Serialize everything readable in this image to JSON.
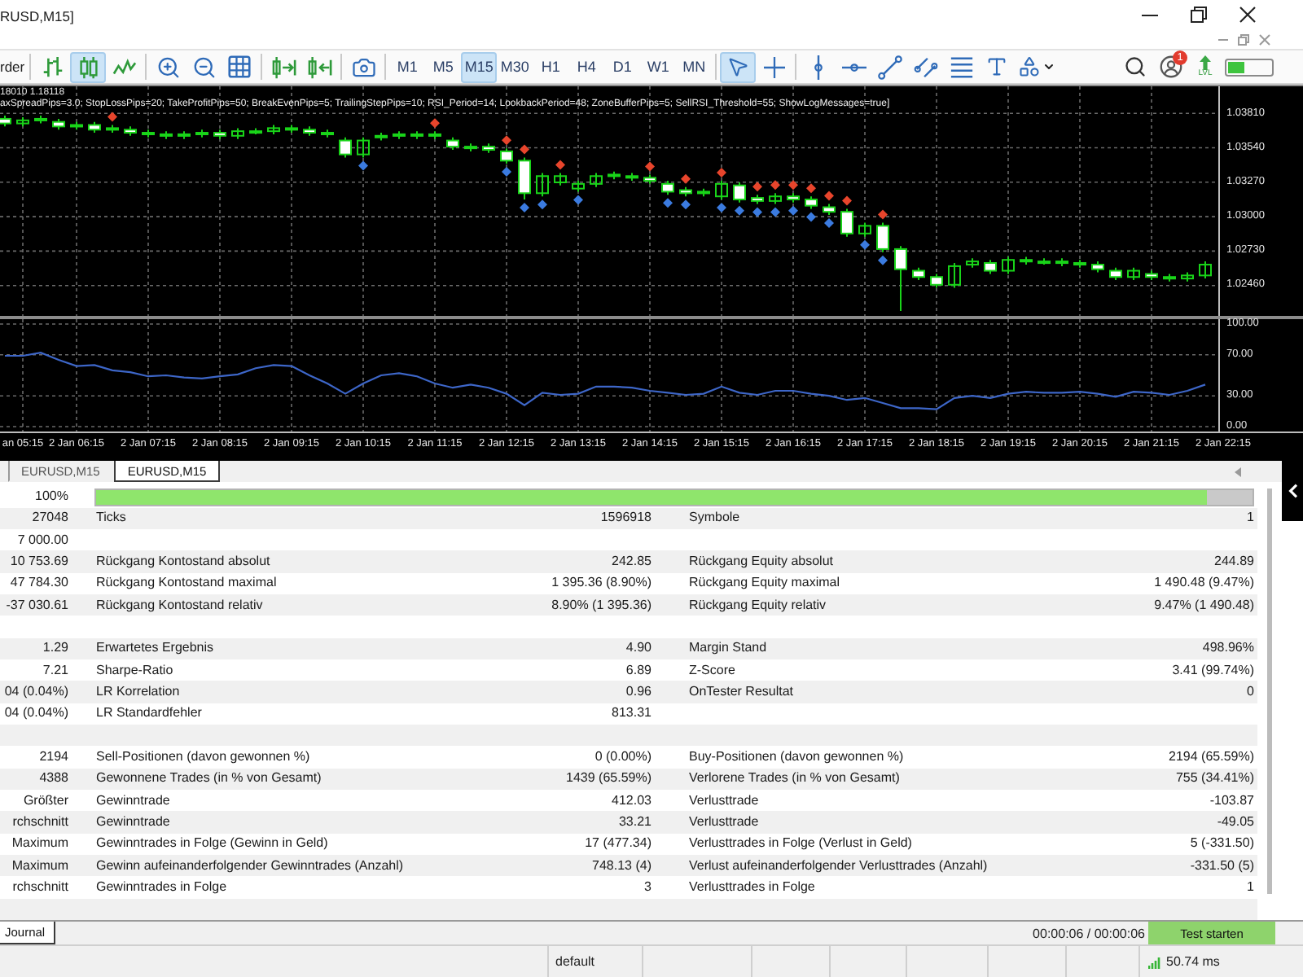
{
  "window": {
    "title": "RUSD,M15]"
  },
  "toolbar": {
    "order_label": "rder",
    "chart_types": [
      {
        "kind": "bars",
        "selected": false
      },
      {
        "kind": "candles",
        "selected": true
      },
      {
        "kind": "line",
        "selected": false
      }
    ],
    "timeframes": [
      {
        "label": "M1",
        "selected": false
      },
      {
        "label": "M5",
        "selected": false
      },
      {
        "label": "M15",
        "selected": true
      },
      {
        "label": "M30",
        "selected": false
      },
      {
        "label": "H1",
        "selected": false
      },
      {
        "label": "H4",
        "selected": false
      },
      {
        "label": "D1",
        "selected": false
      },
      {
        "label": "W1",
        "selected": false
      },
      {
        "label": "MN",
        "selected": false
      }
    ],
    "pointer_tools": [
      {
        "kind": "cursor",
        "selected": true
      },
      {
        "kind": "crosshair",
        "selected": false
      }
    ],
    "object_tools": [
      {
        "kind": "vline",
        "selected": false
      },
      {
        "kind": "hline",
        "selected": false
      },
      {
        "kind": "trendline",
        "selected": false
      },
      {
        "kind": "channel",
        "selected": false
      },
      {
        "kind": "fibo",
        "selected": false
      },
      {
        "kind": "text",
        "selected": false
      },
      {
        "kind": "shapes",
        "selected": false
      }
    ],
    "notification_count": "1",
    "level_label": "LVL"
  },
  "chart": {
    "info": "18010 1.18118",
    "parameters": "axSpreadPips=3.0; StopLossPips=20; TakeProfitPips=50; BreakEvenPips=5; TrailingStepPips=10; RSI_Period=14; LookbackPeriod=48; ZoneBufferPips=5; SellRSI_Threshold=55; ShowLogMessages=true]",
    "chart_data": {
      "type": "candlestick",
      "grid": true,
      "categories": [
        null,
        null,
        null,
        null,
        null,
        null,
        null,
        null,
        null,
        null,
        null,
        null,
        null,
        null,
        null,
        null,
        null,
        null,
        null,
        null,
        null,
        null,
        null,
        null,
        null,
        null,
        null,
        null,
        null,
        null,
        null,
        null,
        null,
        null,
        null,
        null,
        null,
        null,
        null,
        null,
        null,
        null,
        null,
        null,
        null,
        null,
        null,
        null,
        null,
        null,
        null,
        null,
        null,
        null,
        null,
        null,
        null,
        null,
        null,
        null,
        null,
        null,
        null,
        null,
        null,
        null,
        null,
        null
      ],
      "ylim": [
        1.02222,
        1.04022
      ],
      "yticks": [
        {
          "value": 1.0381,
          "label": "1.03810"
        },
        {
          "value": 1.0354,
          "label": "1.03540"
        },
        {
          "value": 1.0327,
          "label": "1.03270"
        },
        {
          "value": 1.03,
          "label": "1.03000"
        },
        {
          "value": 1.0273,
          "label": "1.02730"
        },
        {
          "value": 1.0246,
          "label": "1.02460"
        }
      ],
      "ohlc": [
        [
          1.03767,
          1.03792,
          1.03707,
          1.03731
        ],
        [
          1.03731,
          1.0378,
          1.03707,
          1.03755
        ],
        [
          1.03755,
          1.03792,
          1.03731,
          1.03767
        ],
        [
          1.03743,
          1.03767,
          1.03682,
          1.03707
        ],
        [
          1.03707,
          1.03743,
          1.03682,
          1.03719
        ],
        [
          1.03719,
          1.03743,
          1.03658,
          1.03682
        ],
        [
          1.03694,
          1.03719,
          1.03658,
          1.03682
        ],
        [
          1.03682,
          1.03707,
          1.03634,
          1.03658
        ],
        [
          1.03658,
          1.03682,
          1.03622,
          1.03646
        ],
        [
          1.03646,
          1.0367,
          1.03609,
          1.03634
        ],
        [
          1.03634,
          1.0367,
          1.03609,
          1.03646
        ],
        [
          1.03646,
          1.03682,
          1.03622,
          1.03658
        ],
        [
          1.03658,
          1.03682,
          1.03609,
          1.03634
        ],
        [
          1.03634,
          1.03694,
          1.03609,
          1.0367
        ],
        [
          1.0367,
          1.03694,
          1.03646,
          1.0367
        ],
        [
          1.0367,
          1.03719,
          1.03646,
          1.03694
        ],
        [
          1.03694,
          1.03719,
          1.03658,
          1.03682
        ],
        [
          1.03682,
          1.03707,
          1.03634,
          1.03658
        ],
        [
          1.03658,
          1.03682,
          1.03622,
          1.03646
        ],
        [
          1.03597,
          1.03622,
          1.03463,
          1.03488
        ],
        [
          1.03488,
          1.03622,
          1.03463,
          1.03597
        ],
        [
          1.03622,
          1.03658,
          1.03597,
          1.03634
        ],
        [
          1.03634,
          1.0367,
          1.03609,
          1.03646
        ],
        [
          1.03646,
          1.0367,
          1.03609,
          1.03634
        ],
        [
          1.03634,
          1.0367,
          1.03609,
          1.03646
        ],
        [
          1.03597,
          1.03622,
          1.03524,
          1.03549
        ],
        [
          1.03549,
          1.03573,
          1.03512,
          1.03536
        ],
        [
          1.03549,
          1.03573,
          1.035,
          1.03524
        ],
        [
          1.03512,
          1.03536,
          1.03415,
          1.03439
        ],
        [
          1.03439,
          1.03463,
          1.03135,
          1.03184
        ],
        [
          1.03184,
          1.03342,
          1.03159,
          1.03318
        ],
        [
          1.03269,
          1.03342,
          1.03245,
          1.03318
        ],
        [
          1.0322,
          1.03281,
          1.03196,
          1.03257
        ],
        [
          1.03257,
          1.03342,
          1.03232,
          1.03318
        ],
        [
          1.03318,
          1.03354,
          1.03293,
          1.0333
        ],
        [
          1.03318,
          1.03342,
          1.03281,
          1.03305
        ],
        [
          1.03305,
          1.0333,
          1.03257,
          1.03281
        ],
        [
          1.03257,
          1.03281,
          1.03172,
          1.03196
        ],
        [
          1.03208,
          1.03232,
          1.03159,
          1.03184
        ],
        [
          1.03196,
          1.0322,
          1.03159,
          1.03184
        ],
        [
          1.03159,
          1.03281,
          1.03135,
          1.03257
        ],
        [
          1.03245,
          1.03269,
          1.03111,
          1.03135
        ],
        [
          1.03147,
          1.03172,
          1.03099,
          1.03123
        ],
        [
          1.03123,
          1.03184,
          1.03099,
          1.03159
        ],
        [
          1.03159,
          1.03184,
          1.03111,
          1.03135
        ],
        [
          1.03135,
          1.03159,
          1.03062,
          1.03086
        ],
        [
          1.03074,
          1.03099,
          1.03014,
          1.03038
        ],
        [
          1.03038,
          1.03062,
          1.02843,
          1.02868
        ],
        [
          1.02868,
          1.02953,
          1.02843,
          1.02928
        ],
        [
          1.02928,
          1.02953,
          1.02722,
          1.02746
        ],
        [
          1.02746,
          1.0277,
          1.0226,
          1.02588
        ],
        [
          1.02576,
          1.026,
          1.02503,
          1.02527
        ],
        [
          1.02527,
          1.02551,
          1.02442,
          1.02466
        ],
        [
          1.02466,
          1.02637,
          1.02442,
          1.02612
        ],
        [
          1.02624,
          1.02673,
          1.026,
          1.02649
        ],
        [
          1.02637,
          1.02661,
          1.02551,
          1.02576
        ],
        [
          1.02576,
          1.02685,
          1.02551,
          1.02661
        ],
        [
          1.02649,
          1.02685,
          1.02624,
          1.02661
        ],
        [
          1.02649,
          1.02673,
          1.02624,
          1.02649
        ],
        [
          1.02649,
          1.02673,
          1.02612,
          1.02637
        ],
        [
          1.02637,
          1.02661,
          1.026,
          1.02624
        ],
        [
          1.02624,
          1.02649,
          1.02564,
          1.02588
        ],
        [
          1.02576,
          1.026,
          1.02503,
          1.02527
        ],
        [
          1.02527,
          1.026,
          1.02503,
          1.02576
        ],
        [
          1.02551,
          1.02576,
          1.02503,
          1.02527
        ],
        [
          1.02527,
          1.02551,
          1.02491,
          1.02515
        ],
        [
          1.02515,
          1.02564,
          1.02491,
          1.02539
        ],
        [
          1.02539,
          1.02649,
          1.02515,
          1.02624
        ]
      ]
    },
    "indicator": {
      "chart_data": {
        "type": "line",
        "grid": true,
        "categories": [
          null,
          "an 05:15",
          null,
          null,
          "2 Jan 06:15",
          null,
          null,
          null,
          "2 Jan 07:15",
          null,
          null,
          null,
          "2 Jan 08:15",
          null,
          null,
          null,
          "2 Jan 09:15",
          null,
          null,
          null,
          "2 Jan 10:15",
          null,
          null,
          null,
          "2 Jan 11:15",
          null,
          null,
          null,
          "2 Jan 12:15",
          null,
          null,
          null,
          "2 Jan 13:15",
          null,
          null,
          null,
          "2 Jan 14:15",
          null,
          null,
          null,
          "2 Jan 15:15",
          null,
          null,
          null,
          "2 Jan 16:15",
          null,
          null,
          null,
          "2 Jan 17:15",
          null,
          null,
          null,
          "2 Jan 18:15",
          null,
          null,
          null,
          "2 Jan 19:15",
          null,
          null,
          null,
          "2 Jan 20:15",
          null,
          null,
          null,
          "2 Jan 21:15",
          null,
          null,
          null,
          "2 Jan 22:15"
        ],
        "values": [
          69,
          69,
          72,
          65,
          59,
          60,
          55,
          53,
          49,
          50,
          48,
          47,
          49,
          51,
          57,
          60,
          59,
          50,
          42,
          32,
          42,
          50,
          52,
          49,
          42,
          38,
          41,
          38,
          32,
          21,
          33,
          31,
          32,
          39,
          39,
          38,
          35,
          33,
          31,
          32,
          39,
          33,
          31,
          35,
          35,
          32,
          30,
          26,
          28,
          23,
          18,
          18,
          17,
          28,
          30,
          28,
          32,
          34,
          33,
          33,
          34,
          32,
          29,
          34,
          33,
          31,
          35,
          41,
          null
        ],
        "ylim": [
          0,
          100
        ],
        "yticks": [
          {
            "value": 100,
            "label": "100.00"
          },
          {
            "value": 70,
            "label": "70.00"
          },
          {
            "value": 30,
            "label": "30.00"
          },
          {
            "value": 0,
            "label": "0.00"
          }
        ]
      }
    }
  },
  "chart_tabs": [
    {
      "label": "EURUSD,M15",
      "selected": false
    },
    {
      "label": "EURUSD,M15",
      "selected": true
    }
  ],
  "tester": {
    "progress": {
      "label": "100%",
      "level": 0.96
    },
    "rows": [
      {
        "kind": "data",
        "column_1": "27048",
        "column_2": "Ticks",
        "column_3": "1596918",
        "column_4": "Symbole",
        "column_5": "1"
      },
      {
        "kind": "data",
        "column_1": "7 000.00"
      },
      {
        "kind": "data",
        "column_1": "10 753.69",
        "column_2": "Rückgang Kontostand absolut",
        "column_3": "242.85",
        "column_4": "Rückgang Equity absolut",
        "column_5": "244.89"
      },
      {
        "kind": "data",
        "column_1": "47 784.30",
        "column_2": "Rückgang Kontostand maximal",
        "column_3": "1 395.36 (8.90%)",
        "column_4": "Rückgang Equity maximal",
        "column_5": "1 490.48 (9.47%)"
      },
      {
        "kind": "data",
        "column_1": "-37 030.61",
        "column_2": "Rückgang Kontostand relativ",
        "column_3": "8.90% (1 395.36)",
        "column_4": "Rückgang Equity relativ",
        "column_5": "9.47% (1 490.48)"
      },
      {
        "kind": "spacer"
      },
      {
        "kind": "data",
        "column_1": "1.29",
        "column_2": "Erwartetes Ergebnis",
        "column_3": "4.90",
        "column_4": "Margin Stand",
        "column_5": "498.96%"
      },
      {
        "kind": "data",
        "column_1": "7.21",
        "column_2": "Sharpe-Ratio",
        "column_3": "6.89",
        "column_4": "Z-Score",
        "column_5": "3.41 (99.74%)"
      },
      {
        "kind": "data",
        "column_1": "04 (0.04%)",
        "column_2": "LR Korrelation",
        "column_3": "0.96",
        "column_4": "OnTester Resultat",
        "column_5": "0"
      },
      {
        "kind": "data",
        "column_1": "04 (0.04%)",
        "column_2": "LR Standardfehler",
        "column_3": "813.31"
      },
      {
        "kind": "spacer"
      },
      {
        "kind": "data",
        "column_1": "2194",
        "column_2": "Sell-Positionen (davon gewonnen %)",
        "column_3": "0 (0.00%)",
        "column_4": "Buy-Positionen (davon gewonnen %)",
        "column_5": "2194 (65.59%)"
      },
      {
        "kind": "data",
        "column_1": "4388",
        "column_2": "Gewonnene Trades (in % von Gesamt)",
        "column_3": "1439 (65.59%)",
        "column_4": "Verlorene Trades (in % von Gesamt)",
        "column_5": "755 (34.41%)"
      },
      {
        "kind": "data",
        "column_1": "Größter",
        "column_2": "Gewinntrade",
        "column_3": "412.03",
        "column_4": "Verlusttrade",
        "column_5": "-103.87"
      },
      {
        "kind": "data",
        "column_1": "rchschnitt",
        "column_2": "Gewinntrade",
        "column_3": "33.21",
        "column_4": "Verlusttrade",
        "column_5": "-49.05"
      },
      {
        "kind": "data",
        "column_1": "Maximum",
        "column_2": "Gewinntrades in Folge (Gewinn in Geld)",
        "column_3": "17 (477.34)",
        "column_4": "Verlusttrades in Folge (Verlust in Geld)",
        "column_5": "5 (-331.50)"
      },
      {
        "kind": "data",
        "column_1": "Maximum",
        "column_2": "Gewinn aufeinanderfolgender Gewinntrades (Anzahl)",
        "column_3": "748.13 (4)",
        "column_4": "Verlust aufeinanderfolgender Verlusttrades (Anzahl)",
        "column_5": "-331.50 (5)"
      },
      {
        "kind": "data",
        "column_1": "rchschnitt",
        "column_2": "Gewinntrades in Folge",
        "column_3": "3",
        "column_4": "Verlusttrades in Folge",
        "column_5": "1"
      },
      {
        "kind": "spacer"
      }
    ]
  },
  "bottom_tabs": [
    {
      "label": "Journal",
      "selected": true
    }
  ],
  "test_time": "00:00:06 / 00:00:06",
  "start_button": "Test starten",
  "status_bar": {
    "profile": "default",
    "ping": "50.74 ms"
  }
}
